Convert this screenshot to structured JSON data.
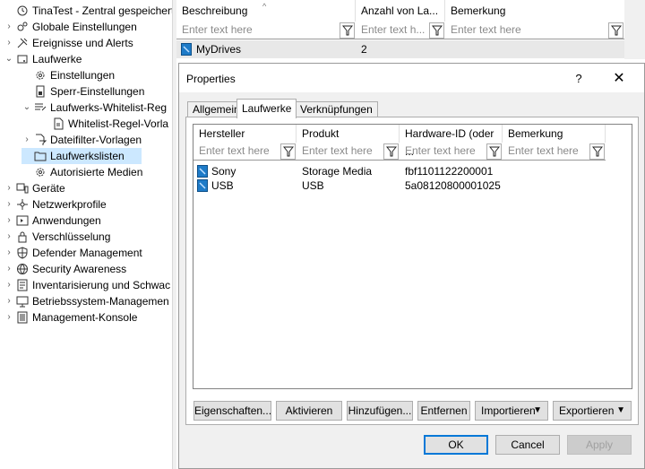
{
  "tree": {
    "items": [
      {
        "label": "TinaTest - Zentral gespeicherte I",
        "expander": "",
        "icon": "sync-shield-icon"
      },
      {
        "label": "Globale Einstellungen",
        "expander": "›",
        "icon": "gears-icon"
      },
      {
        "label": "Ereignisse und Alerts",
        "expander": "›",
        "icon": "tools-icon"
      },
      {
        "label": "Laufwerke",
        "expander": "⌄",
        "icon": "drive-icon"
      },
      {
        "label": "Einstellungen",
        "expander": "",
        "icon": "gear-icon"
      },
      {
        "label": "Sperr-Einstellungen",
        "expander": "",
        "icon": "lock-device-icon"
      },
      {
        "label": "Laufwerks-Whitelist-Reg",
        "expander": "⌄",
        "icon": "list-filter-icon"
      },
      {
        "label": "Whitelist-Regel-Vorla",
        "expander": "",
        "icon": "template-icon"
      },
      {
        "label": "Dateifilter-Vorlagen",
        "expander": "›",
        "icon": "file-filter-icon"
      },
      {
        "label": "Laufwerkslisten",
        "expander": "",
        "icon": "folder-icon"
      },
      {
        "label": "Autorisierte Medien",
        "expander": "",
        "icon": "gear-icon"
      },
      {
        "label": "Geräte",
        "expander": "›",
        "icon": "devices-icon"
      },
      {
        "label": "Netzwerkprofile",
        "expander": "›",
        "icon": "network-icon"
      },
      {
        "label": "Anwendungen",
        "expander": "›",
        "icon": "application-icon"
      },
      {
        "label": "Verschlüsselung",
        "expander": "›",
        "icon": "padlock-icon"
      },
      {
        "label": "Defender Management",
        "expander": "›",
        "icon": "shield-icon"
      },
      {
        "label": "Security Awareness",
        "expander": "›",
        "icon": "globe-icon"
      },
      {
        "label": "Inventarisierung und Schwac",
        "expander": "›",
        "icon": "inventory-icon"
      },
      {
        "label": "Betriebssystem-Managemen",
        "expander": "›",
        "icon": "computer-icon"
      },
      {
        "label": "Management-Konsole",
        "expander": "›",
        "icon": "console-icon"
      }
    ]
  },
  "grid": {
    "columns": [
      "Beschreibung",
      "Anzahl von La...",
      "Bemerkung"
    ],
    "filter_placeholders": [
      "Enter text here",
      "Enter text h...",
      "Enter text here"
    ],
    "rows": [
      {
        "beschreibung": "MyDrives",
        "anzahl": "2",
        "bemerkung": ""
      }
    ]
  },
  "dialog": {
    "title": "Properties",
    "help": "?",
    "close": "✕",
    "tabs": [
      "Allgemein",
      "Laufwerke",
      "Verknüpfungen"
    ],
    "active_tab": "Laufwerke",
    "table": {
      "columns": [
        "Hersteller",
        "Produkt",
        "Hardware-ID (oder ...",
        "Bemerkung"
      ],
      "filter_placeholders": [
        "Enter text here",
        "Enter text here",
        "Enter text here",
        "Enter text here"
      ],
      "rows": [
        {
          "hersteller": "Sony",
          "produkt": "Storage Media",
          "hardware_id": "fbf1101122200001",
          "bemerkung": ""
        },
        {
          "hersteller": "USB",
          "produkt": "USB",
          "hardware_id": "5a08120800001025",
          "bemerkung": ""
        }
      ]
    },
    "buttons": {
      "eigenschaften": "Eigenschaften...",
      "aktivieren": "Aktivieren",
      "hinzufuegen": "Hinzufügen...",
      "entfernen": "Entfernen",
      "importieren": "Importieren",
      "exportieren": "Exportieren"
    },
    "footer": {
      "ok": "OK",
      "cancel": "Cancel",
      "apply": "Apply"
    }
  },
  "colors": {
    "selection": "#cce8ff",
    "accent": "#0078d7",
    "drive_icon": "#1e7bc8"
  }
}
